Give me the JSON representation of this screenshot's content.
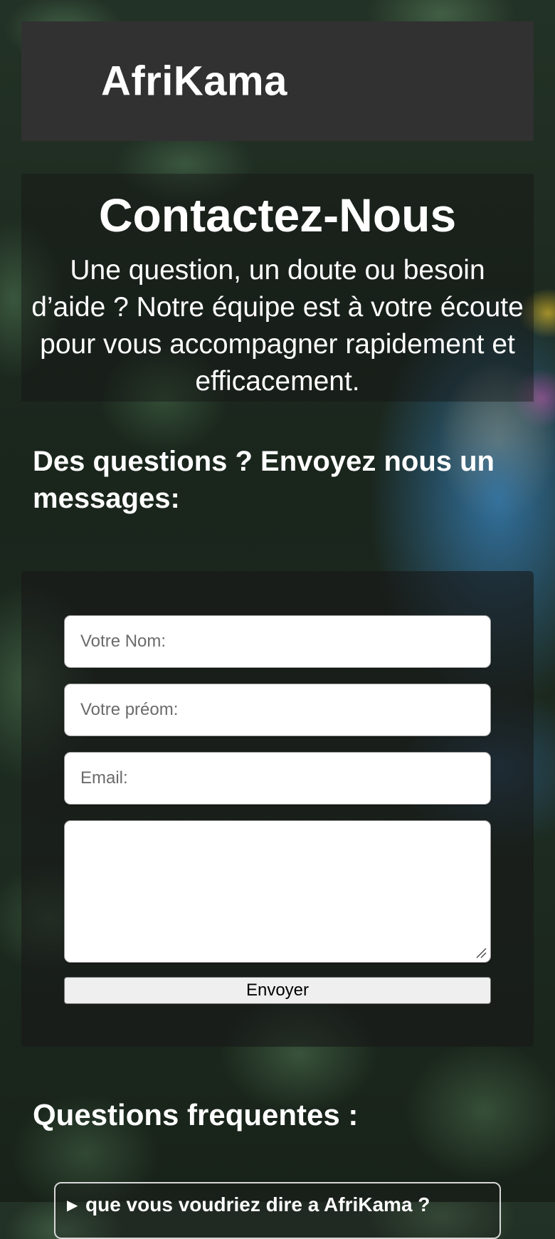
{
  "header": {
    "brand": "AfriKama"
  },
  "intro": {
    "title": "Contactez-Nous",
    "text": "Une question, un doute ou besoin d’aide ? Notre équipe est à votre écoute pour vous accompagner rapidement et efficacement."
  },
  "form": {
    "heading": "Des questions ? Envoyez nous un messages:",
    "name_placeholder": "Votre Nom:",
    "prenom_placeholder": "Votre préom:",
    "email_placeholder": "Email:",
    "message_placeholder": "",
    "submit_label": "Envoyer"
  },
  "faq": {
    "heading": "Questions frequentes :",
    "items": [
      {
        "question": "que vous voudriez dire a AfriKama ?"
      }
    ]
  }
}
